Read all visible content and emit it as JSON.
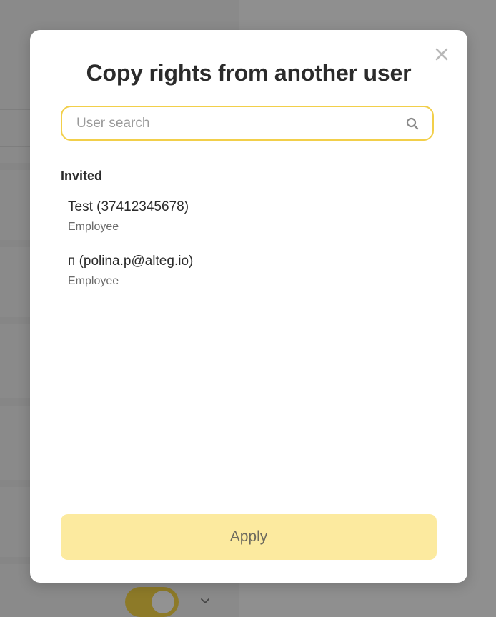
{
  "modal": {
    "title": "Copy rights from another user",
    "close_icon": "close-icon"
  },
  "search": {
    "placeholder": "User search",
    "value": "",
    "icon": "search-icon"
  },
  "section": {
    "label": "Invited"
  },
  "users": [
    {
      "name": "Test (37412345678)",
      "role": "Employee"
    },
    {
      "name": "п (polina.p@alteg.io)",
      "role": "Employee"
    }
  ],
  "footer": {
    "apply_label": "Apply"
  },
  "colors": {
    "accent": "#f2cf4a",
    "apply_bg": "#fcea9f",
    "overlay": "#8f8f8f"
  },
  "background": {
    "toggle": {
      "state": "on",
      "icon": "toggle-icon"
    },
    "dropdown_icon": "chevron-down-icon"
  }
}
